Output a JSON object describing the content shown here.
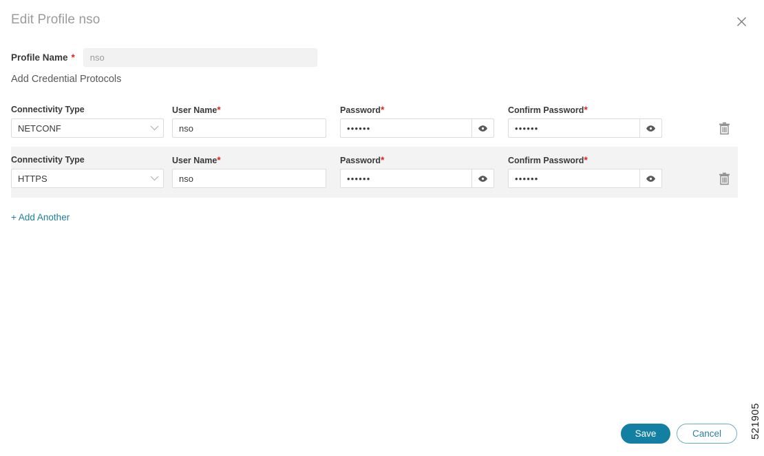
{
  "dialog": {
    "title": "Edit Profile nso",
    "close_icon": "close-icon"
  },
  "profile": {
    "label": "Profile Name",
    "required_marker": "*",
    "value": "nso",
    "placeholder": "nso"
  },
  "section": {
    "heading": "Add Credential Protocols"
  },
  "columns": {
    "connectivity_type": "Connectivity Type",
    "user_name": "User Name",
    "password": "Password",
    "confirm_password": "Confirm Password",
    "required_marker": "*"
  },
  "credential_rows": [
    {
      "connectivity_type": "NETCONF",
      "user_name": "nso",
      "password": "••••••",
      "confirm_password": "••••••",
      "chevron_icon": "chevron-down-icon",
      "eye_icon": "eye-icon",
      "delete_icon": "trash-icon",
      "shaded": false
    },
    {
      "connectivity_type": "HTTPS",
      "user_name": "nso",
      "password": "••••••",
      "confirm_password": "••••••",
      "chevron_icon": "chevron-down-icon",
      "eye_icon": "eye-icon",
      "delete_icon": "trash-icon",
      "shaded": true
    }
  ],
  "add_another": {
    "label": "+ Add Another"
  },
  "footer": {
    "save_label": "Save",
    "cancel_label": "Cancel"
  },
  "figure_number": "521905",
  "colors": {
    "accent_teal": "#137fa3",
    "link_teal": "#1b7f9e",
    "required_red": "#e2231a",
    "row_shade": "#f3f3f3",
    "label_text": "#39393b",
    "title_text": "#9b9b9b"
  }
}
